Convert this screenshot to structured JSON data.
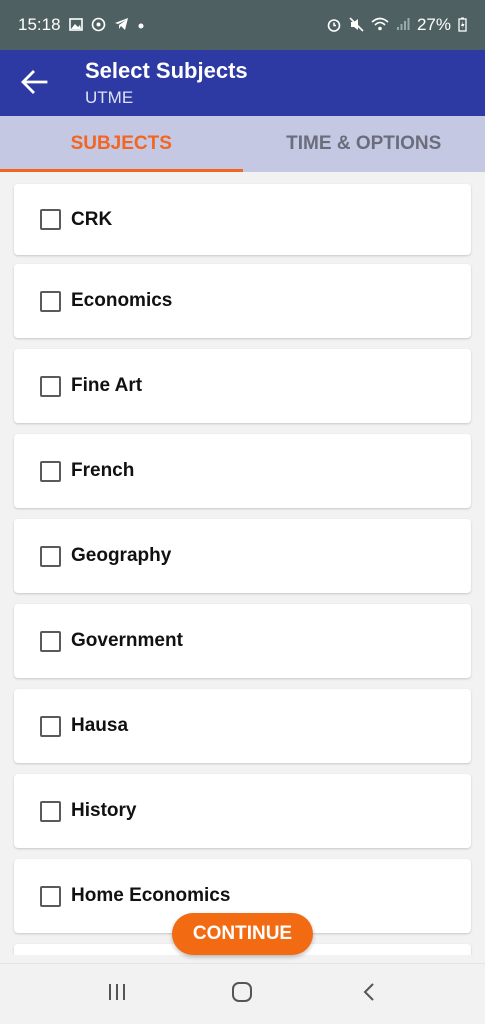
{
  "status_bar": {
    "time": "15:18",
    "battery": "27%"
  },
  "app_bar": {
    "title": "Select Subjects",
    "subtitle": "UTME"
  },
  "tabs": [
    {
      "label": "SUBJECTS",
      "active": true
    },
    {
      "label": "TIME & OPTIONS",
      "active": false
    }
  ],
  "subjects": [
    {
      "label": "CRK",
      "checked": false
    },
    {
      "label": "Economics",
      "checked": false
    },
    {
      "label": "Fine Art",
      "checked": false
    },
    {
      "label": "French",
      "checked": false
    },
    {
      "label": "Geography",
      "checked": false
    },
    {
      "label": "Government",
      "checked": false
    },
    {
      "label": "Hausa",
      "checked": false
    },
    {
      "label": "History",
      "checked": false
    },
    {
      "label": "Home Economics",
      "checked": false
    }
  ],
  "continue_label": "CONTINUE",
  "colors": {
    "accent": "#f26522",
    "app_bar": "#2e3aa4",
    "tab_bar": "#c5c8e3"
  }
}
